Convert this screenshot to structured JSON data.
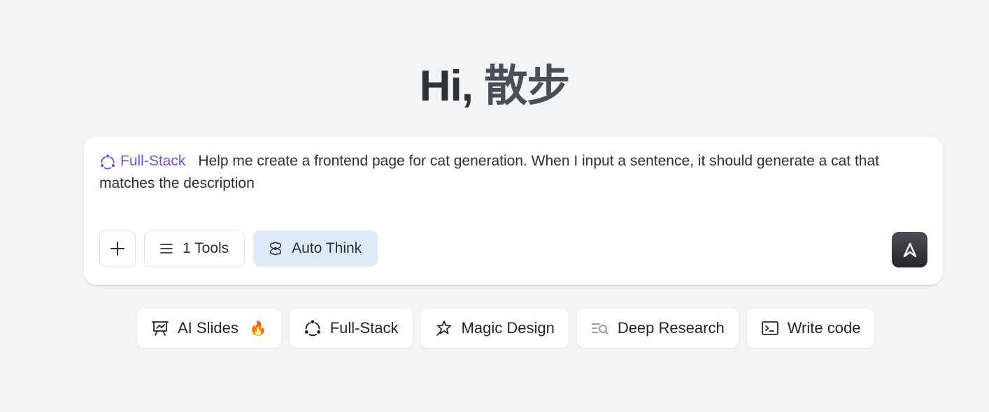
{
  "greeting": {
    "hi": "Hi,",
    "name": "散步"
  },
  "composer": {
    "agent_label": "Full-Stack",
    "agent_icon": "fullstack-icon",
    "agent_color": "#7c4ddb",
    "prompt_text": "Help me create a frontend page for cat generation. When I input a sentence, it should generate a cat that matches the description",
    "toolbar": {
      "add_icon": "plus-icon",
      "tools_label": "1 Tools",
      "tools_icon": "list-icon",
      "auto_think_label": "Auto Think",
      "auto_think_icon": "flower-icon",
      "auto_think_active": true,
      "send_icon": "arrow-up-icon"
    }
  },
  "quick_actions": [
    {
      "label": "AI Slides",
      "icon": "presentation-icon",
      "badge": "🔥"
    },
    {
      "label": "Full-Stack",
      "icon": "fullstack-icon"
    },
    {
      "label": "Magic Design",
      "icon": "magic-star-icon"
    },
    {
      "label": "Deep Research",
      "icon": "research-icon"
    },
    {
      "label": "Write code",
      "icon": "terminal-icon"
    }
  ],
  "colors": {
    "background": "#f3f4f6",
    "accent_purple": "#7c4ddb",
    "active_chip": "#dfeaf8",
    "send_button": "#2f3136"
  }
}
